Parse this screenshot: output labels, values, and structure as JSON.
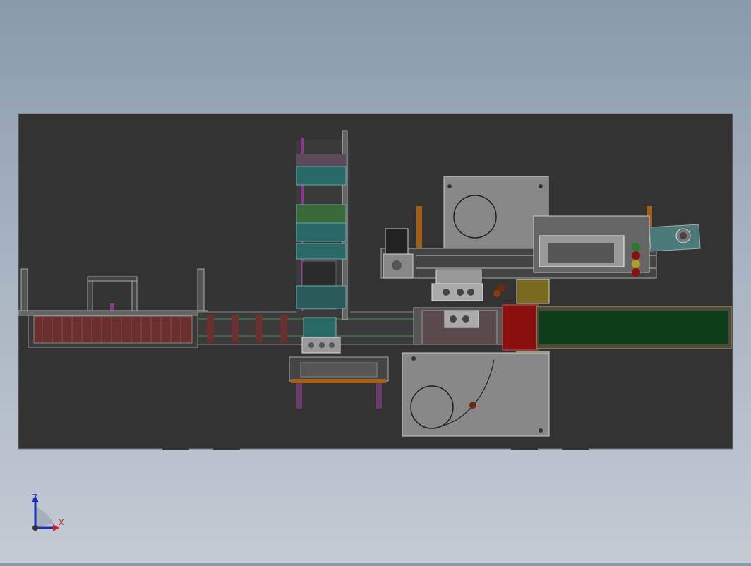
{
  "view": {
    "background_top": "#8a9aab",
    "background_bottom": "#c3cad4",
    "model_fill": "#333333"
  },
  "triad": {
    "z_label": "Z",
    "x_label": "X",
    "z_color": "#1f2cc0",
    "x_color": "#d42020"
  },
  "colors": {
    "conveyor_green": "#0f3d1a",
    "stack_teal": "#2a6a66",
    "stop_red": "#8a1010",
    "bracket_orange": "#a0601a",
    "panel_gray": "#6e6e6e",
    "belt_rust": "#6a3030"
  }
}
